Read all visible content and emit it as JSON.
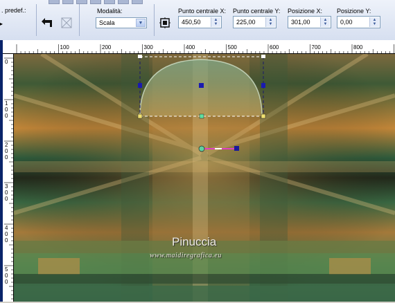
{
  "toolbar": {
    "preset_label": ". predef.:",
    "mode": {
      "label": "Modalità:",
      "value": "Scala"
    },
    "center_x": {
      "label": "Punto centrale X:",
      "value": "450,50"
    },
    "center_y": {
      "label": "Punto centrale Y:",
      "value": "225,00"
    },
    "pos_x": {
      "label": "Posizione X:",
      "value": "301,00"
    },
    "pos_y": {
      "label": "Posizione Y:",
      "value": "0,00"
    }
  },
  "ruler": {
    "h_ticks": [
      "100",
      "200",
      "300",
      "400",
      "500",
      "600",
      "700",
      "800"
    ],
    "v_ticks": [
      "0",
      "1\n0\n0",
      "2\n0\n0",
      "3\n0\n0",
      "4\n0\n0",
      "5\n0\n0"
    ]
  },
  "watermark": {
    "name": "Pinuccia",
    "url": "www.maidiregrafica.eu"
  },
  "icons": [
    "undo-icon",
    "reset-icon",
    "pick-tool-icon",
    "chevron-down-icon"
  ]
}
